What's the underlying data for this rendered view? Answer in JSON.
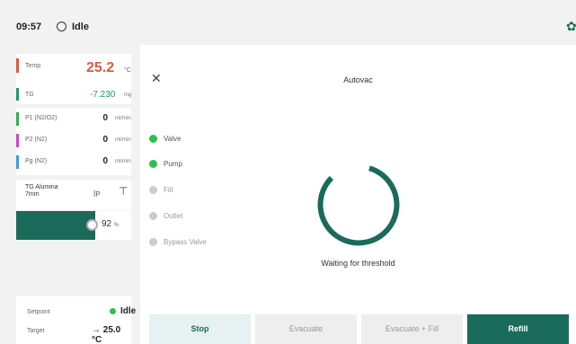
{
  "header": {
    "time": "09:57",
    "status": "Idle",
    "settings_icon": "gear-icon"
  },
  "sidebar": {
    "temp": {
      "label": "Temp",
      "value": "25.2",
      "unit": "°C",
      "color": "#e05a3a"
    },
    "tg": {
      "label": "TG",
      "value": "-7.230",
      "unit": "mg",
      "color": "#1a9b6f"
    },
    "flows": [
      {
        "label": "P1 (N2/O2)",
        "value": "0",
        "unit": "ml/min",
        "color": "#2bb24c"
      },
      {
        "label": "P2 (N2)",
        "value": "0",
        "unit": "ml/min",
        "color": "#d93fd0"
      },
      {
        "label": "Pg (N2)",
        "value": "0",
        "unit": "ml/min",
        "color": "#3a9be0"
      }
    ],
    "crucible": {
      "name_line1": "TG Alumina",
      "name_line2": "7mm",
      "p_label": "ĪP"
    },
    "fill_level": {
      "percent": 92,
      "percent_label": "92",
      "unit": "%"
    },
    "setpoint": {
      "label": "Setpoint",
      "state": "Idle",
      "target_label": "Target",
      "target_value": "→ 25.0 °C"
    }
  },
  "dialog": {
    "title": "Autovac",
    "states": [
      {
        "label": "Valve",
        "active": true
      },
      {
        "label": "Pump",
        "active": true
      },
      {
        "label": "Fill",
        "active": false
      },
      {
        "label": "Outlet",
        "active": false
      },
      {
        "label": "Bypass Valve",
        "active": false
      }
    ],
    "message": "Waiting for threshold",
    "buttons": {
      "stop": "Stop",
      "evacuate": "Evacuate",
      "evacuate_fill": "Evacuate + Fill",
      "refill": "Refill"
    }
  },
  "colors": {
    "accent": "#1a6b59",
    "active_dot": "#2cc24a",
    "inactive_dot": "#cccccc",
    "stop_bg": "#e6f1f2",
    "disabled_bg": "#eeeeee"
  }
}
